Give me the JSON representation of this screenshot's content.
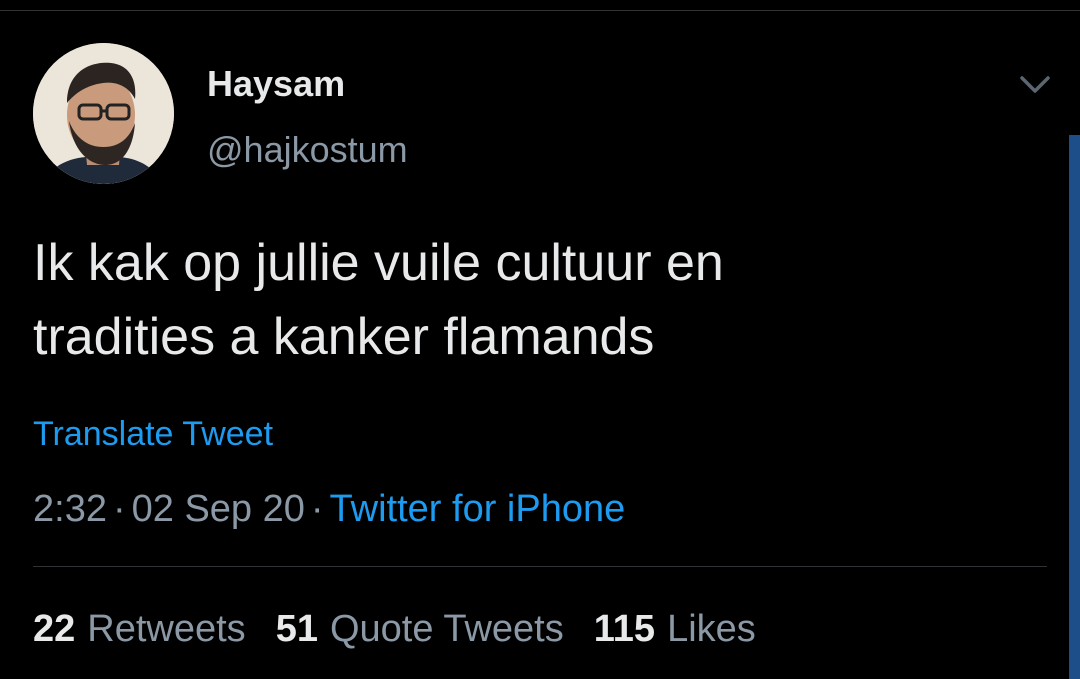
{
  "tweet": {
    "author": {
      "display_name": "Haysam",
      "handle": "@hajkostum",
      "avatar_icon": "profile-photo"
    },
    "text_lines": [
      "Ik kak op jullie vuile cultuur en",
      "tradities a kanker flamands"
    ],
    "translate_label": "Translate Tweet",
    "time": "2:32",
    "date": "02 Sep 20",
    "separator": "·",
    "source": "Twitter for iPhone",
    "stats": {
      "retweets": {
        "count": "22",
        "label": "Retweets"
      },
      "quote_tweets": {
        "count": "51",
        "label": "Quote Tweets"
      },
      "likes": {
        "count": "115",
        "label": "Likes"
      }
    },
    "menu_icon": "chevron-down-icon"
  },
  "colors": {
    "background": "#000000",
    "primary_text": "#e7e9ea",
    "secondary_text": "#8b98a5",
    "link": "#1d9bf0",
    "divider": "#2f3336"
  }
}
